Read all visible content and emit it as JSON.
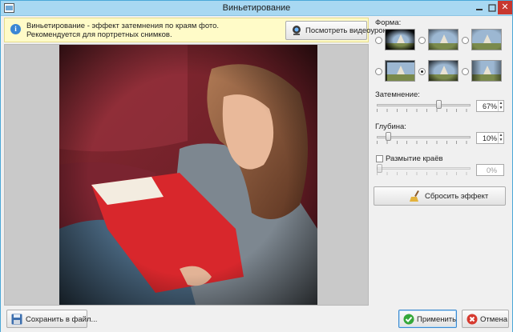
{
  "window": {
    "title": "Виньетирование",
    "close_label": "✕"
  },
  "info": {
    "line1": "Виньетирование - эффект затемнения по краям фото.",
    "line2": "Рекомендуется для портретных снимков.",
    "video_button": "Посмотреть видеоурок"
  },
  "shape": {
    "label": "Форма:",
    "options_count": 6,
    "selected_index": 4
  },
  "darkening": {
    "label": "Затемнение:",
    "value": "67%",
    "level": 0.67
  },
  "depth": {
    "label": "Глубина:",
    "value": "10%",
    "level": 0.1
  },
  "blur": {
    "label": "Размытие краёв",
    "checked": false,
    "value": "0%",
    "level": 0.0
  },
  "reset_button": "Сбросить эффект",
  "bottom": {
    "save_label": "Сохранить в файл...",
    "apply_label": "Применить",
    "cancel_label": "Отмена"
  },
  "colors": {
    "titlebar": "#a8d8f2",
    "info_bg": "#fffbc8",
    "close": "#c7372f",
    "accent": "#3c8ad0"
  }
}
